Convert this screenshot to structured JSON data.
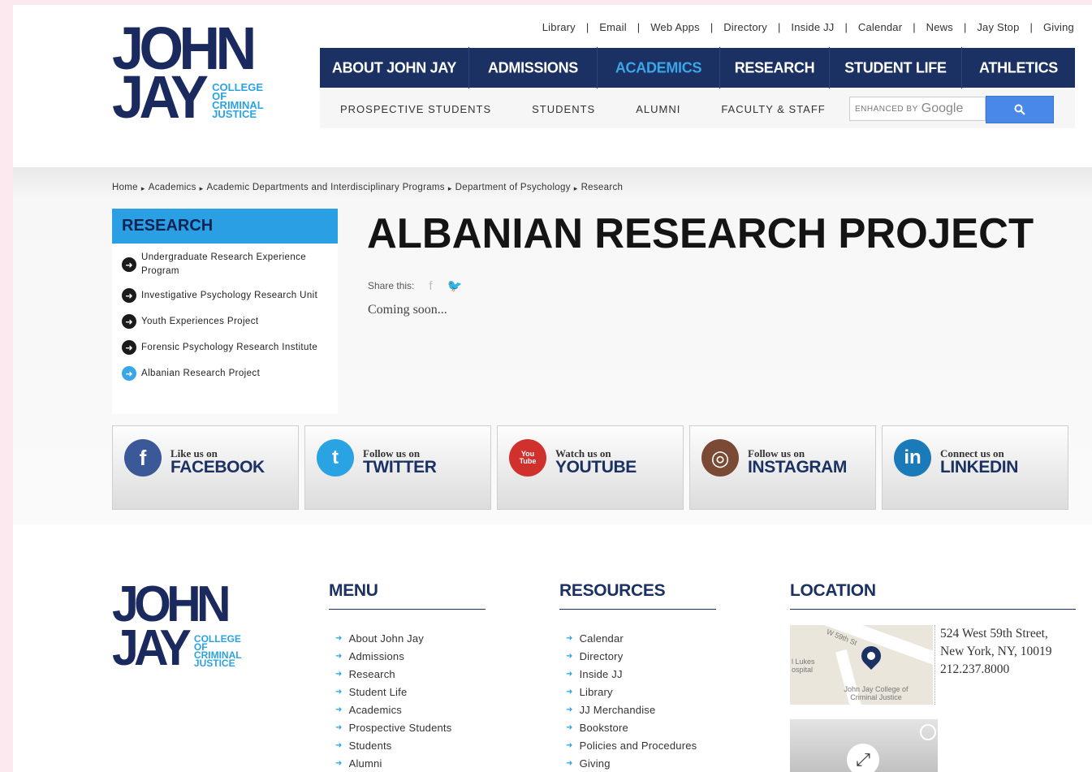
{
  "util_nav": [
    "Library",
    "Email",
    "Web Apps",
    "Directory",
    "Inside JJ",
    "Calendar",
    "News",
    "Jay Stop",
    "Giving"
  ],
  "logo": {
    "line1": "JOHN",
    "line2": "JAY",
    "sub": [
      "COLLEGE",
      "OF",
      "CRIMINAL",
      "JUSTICE"
    ]
  },
  "main_nav": [
    "ABOUT JOHN JAY",
    "ADMISSIONS",
    "ACADEMICS",
    "RESEARCH",
    "STUDENT LIFE",
    "ATHLETICS"
  ],
  "sub_nav": [
    "PROSPECTIVE STUDENTS",
    "STUDENTS",
    "ALUMNI",
    "FACULTY & STAFF"
  ],
  "search": {
    "enhanced_by": "ENHANCED BY",
    "google": "Google"
  },
  "breadcrumb": [
    "Home",
    "Academics",
    "Academic Departments and Interdisciplinary Programs",
    "Department of Psychology",
    "Research"
  ],
  "sidebar": {
    "heading": "RESEARCH",
    "items": [
      "Undergraduate Research Experience Program",
      "Investigative Psychology Research Unit",
      "Youth Experiences Project",
      "Forensic Psychology Research Institute",
      "Albanian Research Project"
    ]
  },
  "main": {
    "title": "ALBANIAN RESEARCH PROJECT",
    "share_label": "Share this:",
    "body": "Coming soon..."
  },
  "social": [
    {
      "small": "Like us on",
      "big": "FACEBOOK",
      "color": "#3b5998",
      "glyph": "f"
    },
    {
      "small": "Follow us on",
      "big": "TWITTER",
      "color": "#2aa3e3",
      "glyph": "t"
    },
    {
      "small": "Watch us on",
      "big": "YOUTUBE",
      "color": "#d0312d",
      "glyph": "You Tube"
    },
    {
      "small": "Follow us on",
      "big": "INSTAGRAM",
      "color": "#7a4a35",
      "glyph": "◎"
    },
    {
      "small": "Connect us on",
      "big": "LINKEDIN",
      "color": "#1b7bb8",
      "glyph": "in"
    }
  ],
  "footer": {
    "menu": {
      "heading": "MENU",
      "links": [
        "About John Jay",
        "Admissions",
        "Research",
        "Student Life",
        "Academics",
        "Prospective Students",
        "Students",
        "Alumni"
      ]
    },
    "resources": {
      "heading": "RESOURCES",
      "links": [
        "Calendar",
        "Directory",
        "Inside JJ",
        "Library",
        "JJ Merchandise",
        "Bookstore",
        "Policies and Procedures",
        "Giving"
      ]
    },
    "location": {
      "heading": "LOCATION",
      "address_line1": "524 West 59th Street,",
      "address_line2": "New York, NY, 10019",
      "phone": "212.237.8000",
      "map_labels": {
        "street": "W 59th St",
        "hospital": "l Lukes ospital",
        "college": "John Jay College of Criminal Justice"
      }
    }
  }
}
